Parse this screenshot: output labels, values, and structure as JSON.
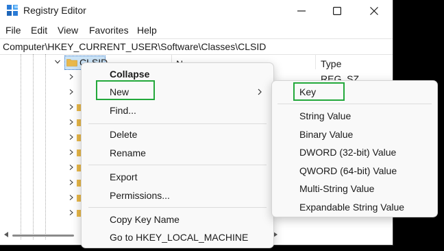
{
  "window": {
    "title": "Registry Editor"
  },
  "menubar": {
    "items": [
      "File",
      "Edit",
      "View",
      "Favorites",
      "Help"
    ]
  },
  "address": {
    "path": "Computer\\HKEY_CURRENT_USER\\Software\\Classes\\CLSID"
  },
  "tree": {
    "selected_key": "CLSID"
  },
  "list": {
    "columns": {
      "name": "N",
      "type": "Type"
    },
    "rows": [
      {
        "type": "REG_SZ"
      }
    ]
  },
  "context_menu": {
    "collapse": "Collapse",
    "new": "New",
    "find": "Find...",
    "delete": "Delete",
    "rename": "Rename",
    "export": "Export",
    "permissions": "Permissions...",
    "copy_key_name": "Copy Key Name",
    "goto": "Go to HKEY_LOCAL_MACHINE"
  },
  "new_submenu": {
    "key": "Key",
    "string": "String Value",
    "binary": "Binary Value",
    "dword": "DWORD (32-bit) Value",
    "qword": "QWORD (64-bit) Value",
    "multi_string": "Multi-String Value",
    "expandable_string": "Expandable String Value"
  },
  "colors": {
    "highlight": "#22a83a",
    "folder": "#e9b84a",
    "selection": "#cce4f7",
    "desktop": "#000000"
  },
  "icons": [
    "registry-app-icon",
    "minimize-icon",
    "maximize-icon",
    "close-icon",
    "chevron-down-icon",
    "chevron-right-icon",
    "folder-icon",
    "submenu-arrow-icon"
  ]
}
